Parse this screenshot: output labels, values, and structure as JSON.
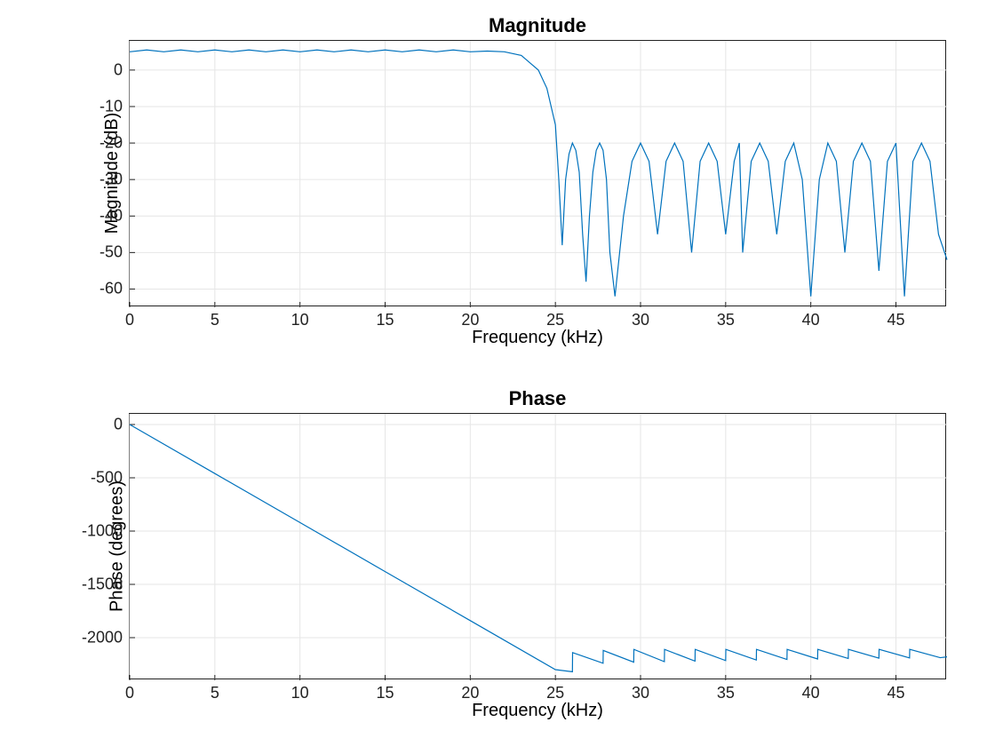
{
  "chart_data": [
    {
      "type": "line",
      "title": "Magnitude",
      "xlabel": "Frequency (kHz)",
      "ylabel": "Magnitude (dB)",
      "xlim": [
        0,
        48
      ],
      "ylim": [
        -65,
        8
      ],
      "xticks": [
        0,
        5,
        10,
        15,
        20,
        25,
        30,
        35,
        40,
        45
      ],
      "yticks": [
        -60,
        -50,
        -40,
        -30,
        -20,
        -10,
        0
      ],
      "line_color": "#0072BD",
      "series": [
        {
          "name": "Magnitude",
          "x": [
            0,
            1,
            2,
            3,
            4,
            5,
            6,
            7,
            8,
            9,
            10,
            11,
            12,
            13,
            14,
            15,
            16,
            17,
            18,
            19,
            20,
            21,
            22,
            23,
            23.5,
            24,
            24.5,
            25,
            25.2,
            25.4,
            25.6,
            25.8,
            26,
            26.2,
            26.4,
            26.6,
            26.8,
            27,
            27.2,
            27.4,
            27.6,
            27.8,
            28,
            28.2,
            28.5,
            29,
            29.5,
            30,
            30.5,
            31,
            31.5,
            32,
            32.5,
            33,
            33.5,
            34,
            34.5,
            35,
            35.5,
            35.8,
            36,
            36.5,
            37,
            37.5,
            38,
            38.5,
            39,
            39.5,
            40,
            40.5,
            41,
            41.5,
            42,
            42.5,
            43,
            43.5,
            44,
            44.5,
            45,
            45.5,
            46,
            46.5,
            47,
            47.5,
            48
          ],
          "y": [
            5,
            5.5,
            5,
            5.5,
            5,
            5.5,
            5,
            5.5,
            5,
            5.5,
            5,
            5.5,
            5,
            5.5,
            5,
            5.5,
            5,
            5.5,
            5,
            5.5,
            5,
            5.2,
            5,
            4,
            2,
            0,
            -5,
            -15,
            -30,
            -48,
            -30,
            -23,
            -20,
            -22,
            -28,
            -45,
            -58,
            -40,
            -28,
            -22,
            -20,
            -22,
            -30,
            -50,
            -62,
            -40,
            -25,
            -20,
            -25,
            -45,
            -25,
            -20,
            -25,
            -50,
            -25,
            -20,
            -25,
            -45,
            -25,
            -20,
            -50,
            -25,
            -20,
            -25,
            -45,
            -25,
            -20,
            -30,
            -62,
            -30,
            -20,
            -25,
            -50,
            -25,
            -20,
            -25,
            -55,
            -25,
            -20,
            -62,
            -25,
            -20,
            -25,
            -45,
            -52
          ]
        }
      ]
    },
    {
      "type": "line",
      "title": "Phase",
      "xlabel": "Frequency (kHz)",
      "ylabel": "Phase (degrees)",
      "xlim": [
        0,
        48
      ],
      "ylim": [
        -2400,
        100
      ],
      "xticks": [
        0,
        5,
        10,
        15,
        20,
        25,
        30,
        35,
        40,
        45
      ],
      "yticks": [
        -2000,
        -1500,
        -1000,
        -500,
        0
      ],
      "line_color": "#0072BD",
      "series": [
        {
          "name": "Phase",
          "x": [
            0,
            5,
            10,
            15,
            20,
            25,
            26,
            26.01,
            27.8,
            27.81,
            29.6,
            29.61,
            31.4,
            31.41,
            33.2,
            33.21,
            35,
            35.01,
            36.8,
            36.81,
            38.6,
            38.61,
            40.4,
            40.41,
            42.2,
            42.21,
            44,
            44.01,
            45.8,
            45.81,
            47.6,
            48
          ],
          "y": [
            0,
            -460,
            -920,
            -1380,
            -1840,
            -2300,
            -2320,
            -2140,
            -2240,
            -2120,
            -2230,
            -2110,
            -2225,
            -2110,
            -2220,
            -2110,
            -2215,
            -2110,
            -2210,
            -2110,
            -2205,
            -2110,
            -2200,
            -2110,
            -2195,
            -2110,
            -2192,
            -2110,
            -2190,
            -2110,
            -2188,
            -2180
          ]
        }
      ]
    }
  ]
}
